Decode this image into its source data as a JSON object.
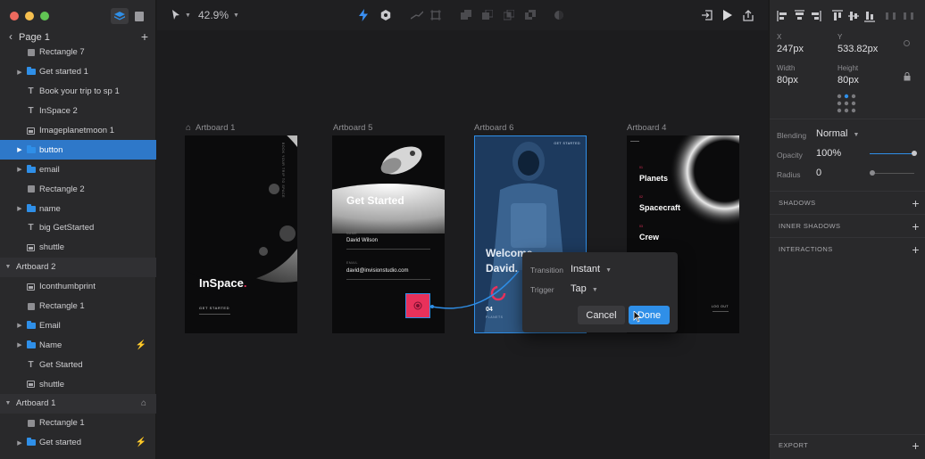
{
  "window": {
    "traffic_colors": [
      "#ed6a5e",
      "#f5bf4f",
      "#61c554"
    ]
  },
  "left_panel": {
    "page_title": "Page 1",
    "layers": [
      {
        "label": "Rectangle 7",
        "icon": "rect",
        "indent": 1,
        "caret": false
      },
      {
        "label": "Get started 1",
        "icon": "folder",
        "indent": 1,
        "caret": true
      },
      {
        "label": "Book your trip to sp 1",
        "icon": "text",
        "indent": 1,
        "caret": false
      },
      {
        "label": "InSpace 2",
        "icon": "text",
        "indent": 1,
        "caret": false
      },
      {
        "label": "Imageplanetmoon 1",
        "icon": "image",
        "indent": 1,
        "caret": false
      },
      {
        "label": "button",
        "icon": "folder",
        "indent": 1,
        "caret": true,
        "selected": true
      },
      {
        "label": "email",
        "icon": "folder",
        "indent": 1,
        "caret": true
      },
      {
        "label": "Rectangle 2",
        "icon": "rect",
        "indent": 1,
        "caret": false
      },
      {
        "label": "name",
        "icon": "folder",
        "indent": 1,
        "caret": true
      },
      {
        "label": "big GetStarted",
        "icon": "text",
        "indent": 1,
        "caret": false
      },
      {
        "label": "shuttle",
        "icon": "image",
        "indent": 1,
        "caret": false
      },
      {
        "label": "Artboard 2",
        "icon": "none",
        "indent": 0,
        "caret": true,
        "group": true,
        "expanded": true
      },
      {
        "label": "Iconthumbprint",
        "icon": "image",
        "indent": 1,
        "caret": false
      },
      {
        "label": "Rectangle 1",
        "icon": "rect",
        "indent": 1,
        "caret": false
      },
      {
        "label": "Email",
        "icon": "folder",
        "indent": 1,
        "caret": true
      },
      {
        "label": "Name",
        "icon": "folder",
        "indent": 1,
        "caret": true,
        "right_icon": "bolt"
      },
      {
        "label": "Get Started",
        "icon": "text",
        "indent": 1,
        "caret": false
      },
      {
        "label": "shuttle",
        "icon": "image",
        "indent": 1,
        "caret": false
      },
      {
        "label": "Artboard 1",
        "icon": "none",
        "indent": 0,
        "caret": true,
        "group": true,
        "expanded": true,
        "right_icon": "home"
      },
      {
        "label": "Rectangle 1",
        "icon": "rect",
        "indent": 1,
        "caret": false
      },
      {
        "label": "Get started",
        "icon": "folder",
        "indent": 1,
        "caret": true,
        "right_icon": "bolt"
      }
    ]
  },
  "toolbar": {
    "zoom": "42.9%"
  },
  "canvas": {
    "artboards": [
      {
        "label": "Artboard 1",
        "home": true
      },
      {
        "label": "Artboard 5"
      },
      {
        "label": "Artboard 6"
      },
      {
        "label": "Artboard 4"
      }
    ],
    "ab1": {
      "title": "InSpace",
      "button": "GET STARTED",
      "vertical": "BOOK YOUR TRIP TO SPACE"
    },
    "ab5": {
      "title": "Get Started",
      "name_label": "NAME",
      "name_value": "David Wilson",
      "email_label": "EMAIL",
      "email_value": "david@invisionstudio.com"
    },
    "ab6": {
      "header": "GET STARTED",
      "welcome": "Welcome,",
      "name": "David.",
      "count": "04",
      "count_label": "PLANETS"
    },
    "ab4": {
      "items": [
        {
          "num": "01",
          "label": "Planets"
        },
        {
          "num": "02",
          "label": "Spacecraft"
        },
        {
          "num": "03",
          "label": "Crew"
        }
      ],
      "footer": "LOG OUT"
    },
    "accent": "#2f8fe8",
    "hotspot": "#e8315b"
  },
  "popover": {
    "transition_label": "Transition",
    "transition_value": "Instant",
    "trigger_label": "Trigger",
    "trigger_value": "Tap",
    "cancel": "Cancel",
    "done": "Done"
  },
  "inspector": {
    "x_label": "X",
    "x_value": "247px",
    "y_label": "Y",
    "y_value": "533.82px",
    "width_label": "Width",
    "width_value": "80px",
    "height_label": "Height",
    "height_value": "80px",
    "blending_label": "Blending",
    "blending_value": "Normal",
    "opacity_label": "Opacity",
    "opacity_value": "100%",
    "opacity_level": 1.0,
    "radius_label": "Radius",
    "radius_value": "0",
    "radius_level": 0.0,
    "sections": [
      {
        "label": "SHADOWS"
      },
      {
        "label": "INNER SHADOWS"
      },
      {
        "label": "INTERACTIONS"
      },
      {
        "label": "EXPORT"
      }
    ]
  }
}
